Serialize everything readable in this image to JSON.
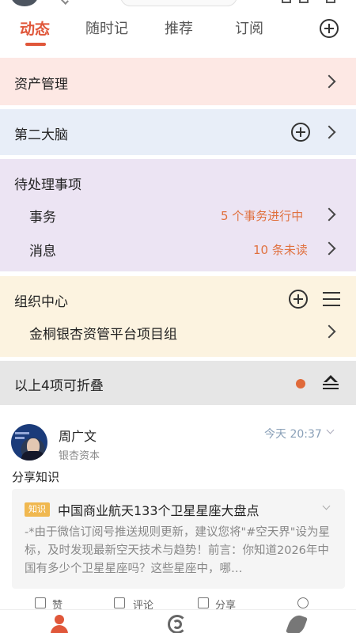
{
  "tabs": [
    {
      "label": "动态",
      "active": true
    },
    {
      "label": "随时记",
      "active": false
    },
    {
      "label": "推荐",
      "active": false
    },
    {
      "label": "订阅",
      "active": false
    }
  ],
  "sections": {
    "asset": {
      "title": "资产管理"
    },
    "brain": {
      "title": "第二大脑"
    },
    "todo": {
      "title": "待处理事项",
      "rows": [
        {
          "label": "事务",
          "status": "5 个事务进行中"
        },
        {
          "label": "消息",
          "status": "10 条未读"
        }
      ]
    },
    "org": {
      "title": "组织中心",
      "rows": [
        {
          "label": "金桐银杏资管平台项目组"
        }
      ]
    },
    "fold": {
      "title": "以上4项可折叠"
    }
  },
  "post": {
    "author": "周广文",
    "org": "银杏资本",
    "time": "今天 20:37",
    "content": "分享知识",
    "card": {
      "tag": "知识",
      "title": "中国商业航天133个卫星星座大盘点",
      "body": "-*由于微信订阅号推送规则更新，建议您将\"#空天界\"设为星标，及时发现最新空天技术与趋势！前言：你知道2026年中国有多少个卫星星座吗？这些星座中，哪…"
    },
    "actions": {
      "like": "赞",
      "comment": "评论",
      "share": "分享"
    }
  },
  "colors": {
    "accent": "#e0573a",
    "status": "#e0713f"
  }
}
